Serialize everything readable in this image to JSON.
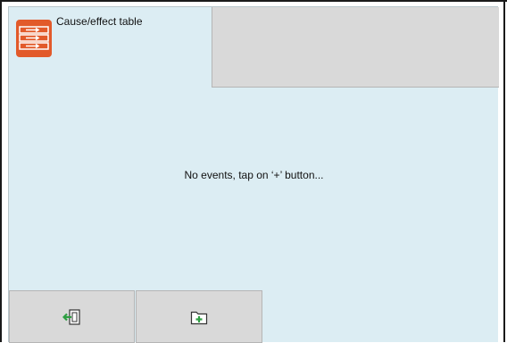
{
  "header": {
    "title": "Cause/effect table",
    "icon": "cause-effect-table-icon",
    "accent_color": "#e25a2a"
  },
  "main": {
    "empty_message": "No events, tap on ‘+’ button..."
  },
  "footer": {
    "exit_icon": "exit-icon",
    "add_icon": "add-folder-icon",
    "exit_icon_color": "#2e9e42",
    "add_icon_color": "#2e9e42"
  }
}
